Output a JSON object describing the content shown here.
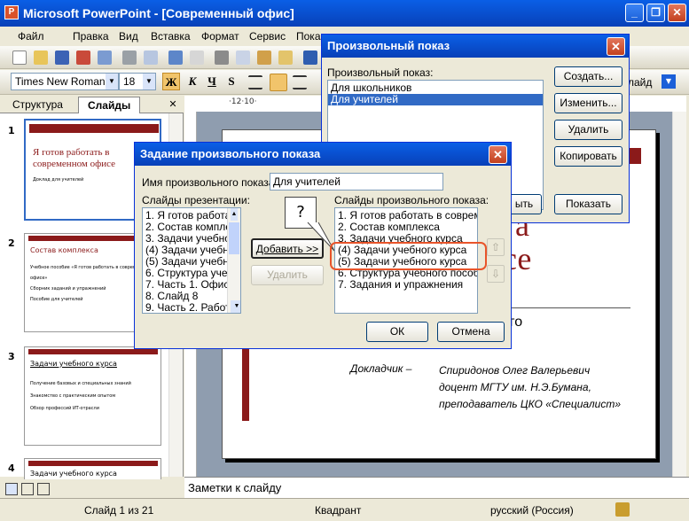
{
  "app": {
    "title": "Microsoft PowerPoint - [Современный офис]",
    "minimize": "_",
    "restore": "❐",
    "close": "✕"
  },
  "menu": [
    "Файл",
    "Правка",
    "Вид",
    "Вставка",
    "Формат",
    "Сервис",
    "Показ"
  ],
  "format": {
    "font": "Times New Roman",
    "size": "18",
    "bold": "Ж",
    "italic": "К",
    "underline": "Ч",
    "shadow": "S",
    "right_tail": "лайд"
  },
  "ruler_text": "·12·10·",
  "left_tabs": {
    "structure": "Структура",
    "slides": "Слайды"
  },
  "thumbs": [
    {
      "num": "1",
      "title": "Я готов работать в современном офисе",
      "sub": "Доклад для учителей"
    },
    {
      "num": "2",
      "title": "Состав комплекса",
      "bullets": [
        "Учебное пособие «Я готов работать в современном офисе»",
        "Сборник заданий и упражнений",
        "Пособие для учителей"
      ]
    },
    {
      "num": "3",
      "title": "Задачи учебного курса",
      "bullets": [
        "Получение базовых и специальных знаний",
        "Знакомство с практическим опытом",
        "Обзор профессий ИТ-отрасли"
      ]
    },
    {
      "num": "4",
      "title": "Задачи учебного курса"
    }
  ],
  "slide": {
    "big1": "а",
    "big2": "се",
    "mid": "ного",
    "reporter_label": "Докладчик –",
    "reporter": [
      "Спиридонов Олег Валерьевич",
      "доцент МГТУ им. Н.Э.Бумана,",
      "преподаватель ЦКО «Специалист»"
    ]
  },
  "notes_placeholder": "Заметки к слайду",
  "status": {
    "slide": "Слайд 1 из 21",
    "design": "Квадрант",
    "lang": "русский (Россия)"
  },
  "show_dialog": {
    "title": "Произвольный показ",
    "list_label": "Произвольный показ:",
    "items": [
      "Для школьников",
      "Для учителей"
    ],
    "buttons": [
      "Создать...",
      "Изменить...",
      "Удалить",
      "Копировать",
      "Показать"
    ],
    "partial_button": "ыть"
  },
  "define_dialog": {
    "title": "Задание произвольного показа",
    "name_label": "Имя произвольного показа:",
    "name_value": "Для учителей",
    "src_label": "Слайды презентации:",
    "src_items": [
      "1. Я готов работать",
      "2. Состав комплек",
      "3. Задачи учебно",
      "(4) Задачи учебно",
      "(5) Задачи учебно",
      "6. Структура учеб",
      "7. Часть 1. Офисн",
      "8. Слайд 8",
      "9. Часть 2. Работ"
    ],
    "add_button": "Добавить >>",
    "remove_button": "Удалить",
    "dst_label": "Слайды произвольного показа:",
    "dst_items": [
      "1. Я готов работать в современ",
      "2. Состав комплекса",
      "3. Задачи учебного курса",
      "(4) Задачи учебного курса",
      "(5) Задачи учебного курса",
      "6. Структура учебного пособи",
      "7. Задания и упражнения"
    ],
    "ok": "ОК",
    "cancel": "Отмена",
    "callout": "?"
  },
  "colors": {
    "accent": "#8b1a1a",
    "select": "#316ac5",
    "highlight": "#e8542a"
  }
}
